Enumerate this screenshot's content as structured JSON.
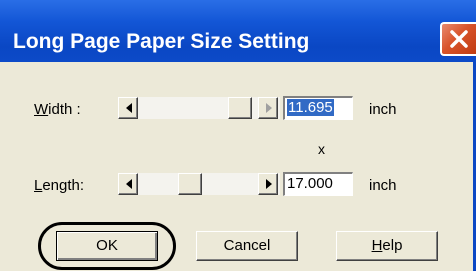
{
  "dialog": {
    "title": "Long Page Paper Size Setting",
    "close_icon": "close-icon"
  },
  "width_row": {
    "label_mnemonic": "W",
    "label_rest": "idth :",
    "value": "11.695",
    "unit": "inch"
  },
  "separator": "x",
  "length_row": {
    "label_mnemonic": "L",
    "label_rest": "ength:",
    "value": "17.000",
    "unit": "inch"
  },
  "buttons": {
    "ok": "OK",
    "cancel": "Cancel",
    "help_mnemonic": "H",
    "help_rest": "elp"
  },
  "colors": {
    "titlebar": "#0a47c4",
    "dialog_bg": "#ece9d8",
    "selection": "#316ac5",
    "close_button": "#d8532a"
  }
}
